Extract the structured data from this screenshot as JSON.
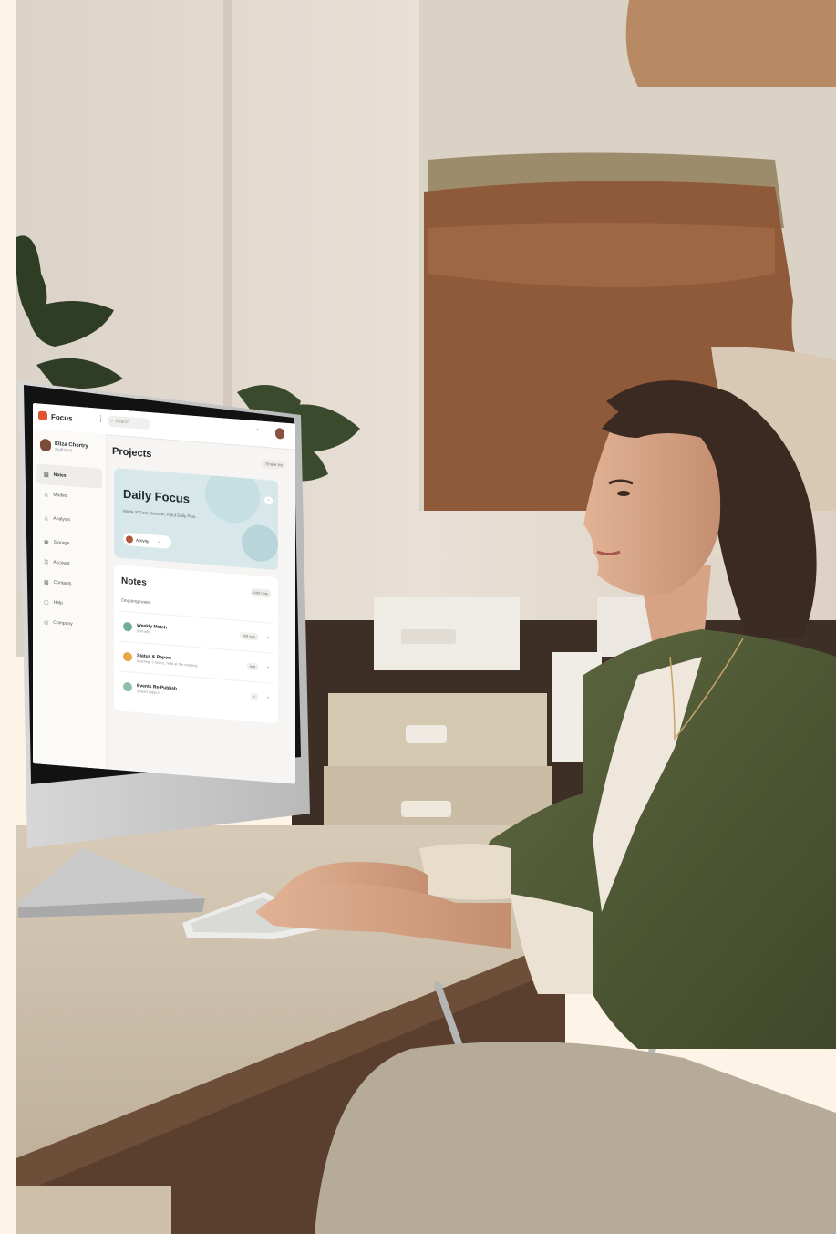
{
  "app": {
    "logo_label": "Focus",
    "search_placeholder": "Search",
    "user_name": "Eliza Chertry",
    "user_sub": "Staff lead"
  },
  "sidebar": {
    "items": [
      {
        "label": "Notes",
        "icon": "note-icon",
        "active": true
      },
      {
        "label": "Modes",
        "icon": "user-icon"
      },
      {
        "label": "Analysis",
        "icon": "person-icon"
      },
      {
        "label": "Storage",
        "icon": "archive-icon"
      },
      {
        "label": "Account",
        "icon": "list-icon"
      },
      {
        "label": "Contacts",
        "icon": "calendar-icon"
      },
      {
        "label": "Help",
        "icon": "help-icon"
      },
      {
        "label": "Company",
        "icon": "globe-icon"
      }
    ]
  },
  "main": {
    "title": "Projects",
    "header_button": "Share list",
    "hero": {
      "title": "Daily Focus",
      "subtitle": "Made of Goal, Session, Input Daily Plus.",
      "selector_label": "Activity"
    },
    "notes": {
      "title": "Notes",
      "action": "Add note",
      "subtitle": "Ongoing notes",
      "items": [
        {
          "title": "Weekly Match",
          "sub": "@ready",
          "badge": "Add note",
          "dot": "#6fae98"
        },
        {
          "title": "Status & Report",
          "sub": "Meeting, 3 topics, held at the meeting",
          "badge": "Add",
          "dot": "#e7a74a"
        },
        {
          "title": "Events Re-Publish",
          "sub": "@lead support",
          "badge": "+",
          "dot": "#8cc3a7"
        }
      ]
    }
  },
  "colors": {
    "accent": "#e0532f",
    "hero_bg": "#d8e7ea",
    "wall": "#e9e1d7",
    "desk": "#cfc3b0"
  }
}
